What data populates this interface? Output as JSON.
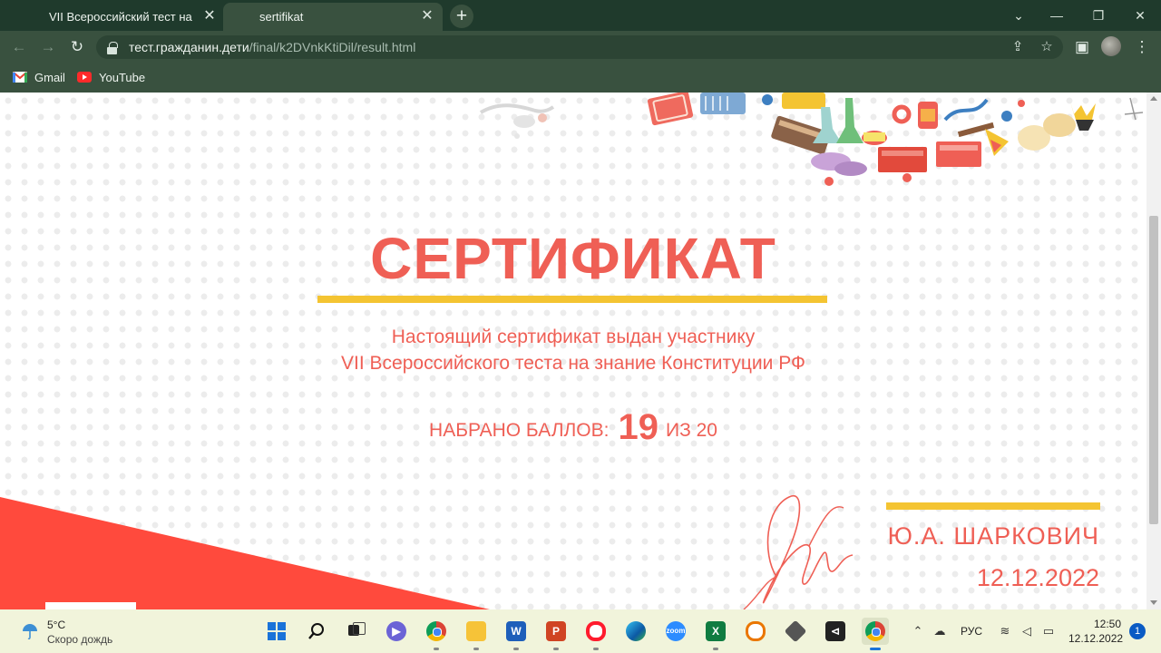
{
  "browser": {
    "tabs": [
      {
        "title": "VII Всероссийский тест на знание Конституции РФ",
        "active": false
      },
      {
        "title": "sertifikat",
        "active": true
      }
    ],
    "url_host": "тест.гражданин.дети",
    "url_path": "/final/k2DVnkKtiDil/result.html",
    "bookmarks": [
      {
        "label": "Gmail",
        "icon": "gmail-icon"
      },
      {
        "label": "YouTube",
        "icon": "youtube-icon"
      }
    ]
  },
  "certificate": {
    "title": "СЕРТИФИКАТ",
    "issued_line1": "Настоящий сертификат выдан участнику",
    "issued_line2": "VII Всероссийского теста на знание Конституции РФ",
    "score_label": "НАБРАНО БАЛЛОВ:",
    "score_value": "19",
    "score_of": "ИЗ 20",
    "signer": "Ю.А. ШАРКОВИЧ",
    "date": "12.12.2022",
    "colors": {
      "accent_red": "#ef5f55",
      "accent_yellow": "#f4c432"
    }
  },
  "taskbar": {
    "weather_temp": "5°C",
    "weather_desc": "Скоро дождь",
    "language": "РУС",
    "time": "12:50",
    "date": "12.12.2022",
    "notifications": "1",
    "apps": [
      "windows-start",
      "search",
      "task-view",
      "chat",
      "chrome",
      "file-explorer",
      "word",
      "powerpoint",
      "opera",
      "edge",
      "zoom",
      "excel",
      "blender",
      "unity",
      "visual-studio",
      "chrome-active"
    ]
  }
}
